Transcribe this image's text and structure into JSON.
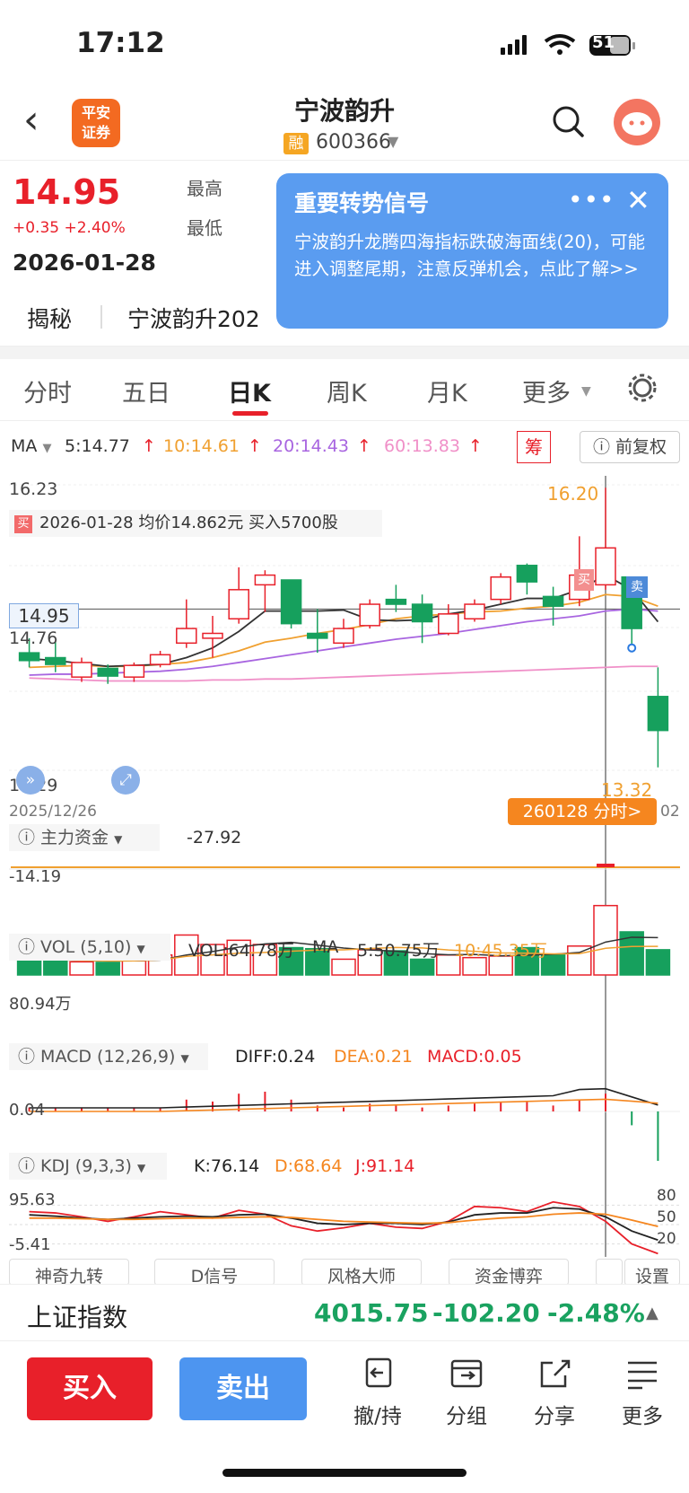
{
  "status_bar": {
    "time": "17:12",
    "battery": "51"
  },
  "header": {
    "back_icon": "chevron-left-icon",
    "logo_text": "平安\n证券",
    "stock_name": "宁波韵升",
    "rong_badge": "融",
    "stock_code": "600366"
  },
  "quote": {
    "price": "14.95",
    "change": "+0.35 +2.40%",
    "date": "2026-01-28",
    "high_label": "最高",
    "low_label": "最低"
  },
  "popup": {
    "title": "重要转势信号",
    "body": "宁波韵升龙腾四海指标跌破海面线(20)，可能进入调整尾期，注意反弹机会，点此了解>>",
    "more": "•••",
    "close": "✕"
  },
  "reveal": {
    "label": "揭秘",
    "text": "宁波韵升202"
  },
  "tabs": [
    {
      "label": "分时"
    },
    {
      "label": "五日"
    },
    {
      "label": "日K"
    },
    {
      "label": "周K"
    },
    {
      "label": "月K"
    },
    {
      "label": "更多"
    }
  ],
  "ma_row": {
    "ma": "MA",
    "ma5": "5:14.77",
    "ma10": "10:14.61",
    "ma20": "20:14.43",
    "ma60": "60:13.83",
    "chou": "筹",
    "fuquan": "前复权"
  },
  "colors": {
    "up": "#e8202a",
    "down": "#16a05d",
    "ma5": "#333333",
    "ma10": "#f0a030",
    "ma20": "#a865e0",
    "ma60": "#f090c8",
    "orange": "#f5861f"
  },
  "chart_data": {
    "type": "candlestick",
    "ylim": [
      13.29,
      16.23
    ],
    "y_ticks": [
      "16.23",
      "14.76",
      "13.29"
    ],
    "last_price_label": "14.95",
    "max_label": "16.20",
    "min_label": "13.32",
    "date_start": "2025/12/26",
    "date_end": "02",
    "trade_note": {
      "badge": "买",
      "text": "2026-01-28 均价14.862元 买入5700股"
    },
    "buy_mark": "买",
    "sell_mark": "卖",
    "fenshi_button": "260128 分时>",
    "candles": [
      {
        "o": 14.5,
        "c": 14.42,
        "h": 14.65,
        "l": 14.35
      },
      {
        "o": 14.45,
        "c": 14.38,
        "h": 14.62,
        "l": 14.3
      },
      {
        "o": 14.25,
        "c": 14.4,
        "h": 14.45,
        "l": 14.2
      },
      {
        "o": 14.34,
        "c": 14.26,
        "h": 14.38,
        "l": 14.18
      },
      {
        "o": 14.25,
        "c": 14.37,
        "h": 14.4,
        "l": 14.2
      },
      {
        "o": 14.38,
        "c": 14.48,
        "h": 14.52,
        "l": 14.35
      },
      {
        "o": 14.6,
        "c": 14.75,
        "h": 15.05,
        "l": 14.55
      },
      {
        "o": 14.65,
        "c": 14.7,
        "h": 14.88,
        "l": 14.45
      },
      {
        "o": 14.85,
        "c": 15.15,
        "h": 15.38,
        "l": 14.8
      },
      {
        "o": 15.2,
        "c": 15.3,
        "h": 15.35,
        "l": 14.92
      },
      {
        "o": 15.25,
        "c": 14.8,
        "h": 15.25,
        "l": 14.75
      },
      {
        "o": 14.7,
        "c": 14.65,
        "h": 14.95,
        "l": 14.5
      },
      {
        "o": 14.6,
        "c": 14.75,
        "h": 14.85,
        "l": 14.55
      },
      {
        "o": 14.78,
        "c": 15.0,
        "h": 15.05,
        "l": 14.75
      },
      {
        "o": 15.05,
        "c": 15.0,
        "h": 15.2,
        "l": 14.92
      },
      {
        "o": 15.0,
        "c": 14.82,
        "h": 15.1,
        "l": 14.6
      },
      {
        "o": 14.7,
        "c": 14.9,
        "h": 15.0,
        "l": 14.68
      },
      {
        "o": 14.85,
        "c": 15.0,
        "h": 15.05,
        "l": 14.82
      },
      {
        "o": 15.05,
        "c": 15.28,
        "h": 15.32,
        "l": 15.0
      },
      {
        "o": 15.4,
        "c": 15.23,
        "h": 15.42,
        "l": 15.1
      },
      {
        "o": 15.08,
        "c": 14.98,
        "h": 15.18,
        "l": 14.78
      },
      {
        "o": 15.05,
        "c": 15.3,
        "h": 15.7,
        "l": 14.98
      },
      {
        "o": 15.2,
        "c": 15.58,
        "h": 16.2,
        "l": 15.15
      },
      {
        "o": 15.28,
        "c": 14.75,
        "h": 15.28,
        "l": 14.52
      },
      {
        "o": 14.05,
        "c": 13.7,
        "h": 14.35,
        "l": 13.32
      }
    ],
    "ma5": [
      14.44,
      14.42,
      14.39,
      14.36,
      14.37,
      14.38,
      14.45,
      14.55,
      14.72,
      14.93,
      14.93,
      14.93,
      14.94,
      14.84,
      14.83,
      14.84,
      14.9,
      14.94,
      15.0,
      15.06,
      15.06,
      15.15,
      15.3,
      15.15,
      14.82
    ],
    "ma10": [
      14.35,
      14.36,
      14.37,
      14.36,
      14.36,
      14.38,
      14.4,
      14.45,
      14.52,
      14.61,
      14.65,
      14.7,
      14.74,
      14.79,
      14.85,
      14.88,
      14.9,
      14.92,
      14.93,
      14.96,
      14.98,
      15.02,
      15.1,
      15.08,
      14.98
    ],
    "ma20": [
      14.27,
      14.28,
      14.28,
      14.29,
      14.3,
      14.31,
      14.33,
      14.36,
      14.4,
      14.44,
      14.48,
      14.52,
      14.56,
      14.6,
      14.64,
      14.67,
      14.7,
      14.74,
      14.78,
      14.82,
      14.85,
      14.88,
      14.93,
      14.95,
      14.93
    ],
    "ma60": [
      14.24,
      14.23,
      14.22,
      14.21,
      14.21,
      14.21,
      14.21,
      14.22,
      14.22,
      14.23,
      14.23,
      14.24,
      14.25,
      14.26,
      14.27,
      14.28,
      14.29,
      14.3,
      14.31,
      14.32,
      14.33,
      14.34,
      14.35,
      14.36,
      14.36
    ],
    "zhuli": {
      "label": "主力资金",
      "value": "-27.92",
      "axis": "-14.19"
    },
    "vol": {
      "label": "VOL (5,10)",
      "vol": "VOL:64.78万",
      "ma": "MA",
      "ma5": "5:50.75万",
      "ma10": "10:45.35万",
      "axis": "80.94万",
      "values": [
        30,
        28,
        25,
        24,
        27,
        38,
        76,
        58,
        66,
        58,
        52,
        50,
        30,
        48,
        46,
        30,
        38,
        33,
        36,
        52,
        38,
        55,
        132,
        82,
        48
      ]
    },
    "macd": {
      "label": "MACD (12,26,9)",
      "diff": "DIFF:0.24",
      "dea": "DEA:0.21",
      "macd": "MACD:0.05",
      "axis": "0.04",
      "hist": [
        0.02,
        0.02,
        0.02,
        0.02,
        0.02,
        0.02,
        0.06,
        0.05,
        0.09,
        0.1,
        0.06,
        0.03,
        0.02,
        0.04,
        0.03,
        0.02,
        0.03,
        0.04,
        0.05,
        0.05,
        0.03,
        0.06,
        0.09,
        -0.07,
        -0.25
      ]
    },
    "kdj": {
      "label": "KDJ (9,3,3)",
      "k": "K:76.14",
      "d": "D:68.64",
      "j": "J:91.14",
      "axis_top": "95.63",
      "axis_bottom": "-5.41",
      "levels": [
        "80",
        "50",
        "20"
      ]
    },
    "bottom_tabs": [
      "神奇九转",
      "D信号",
      "风格大师",
      "资金博弈",
      "设置"
    ]
  },
  "index": {
    "name": "上证指数",
    "value": "4015.75",
    "change": "-102.20",
    "pct": "-2.48%"
  },
  "actions": {
    "buy": "买入",
    "sell": "卖出",
    "items": [
      {
        "icon": "undo-icon",
        "label": "撤/持"
      },
      {
        "icon": "folder-icon",
        "label": "分组"
      },
      {
        "icon": "share-icon",
        "label": "分享"
      },
      {
        "icon": "menu-icon",
        "label": "更多"
      }
    ]
  }
}
